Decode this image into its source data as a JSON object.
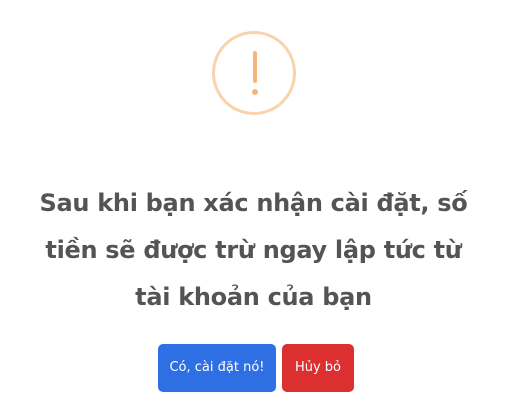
{
  "dialog": {
    "icon": "exclamation-warning-icon",
    "message": "Sau khi bạn xác nhận cài đặt, số tiền sẽ được trừ ngay lập tức từ tài khoản của bạn",
    "confirm_label": "Có, cài đặt nó!",
    "cancel_label": "Hủy bỏ"
  },
  "colors": {
    "icon_ring": "#f8d3ad",
    "icon_mark": "#f6b67a",
    "message_text": "#545454",
    "confirm_button": "#2f6fe4",
    "cancel_button": "#dc2f2f"
  }
}
